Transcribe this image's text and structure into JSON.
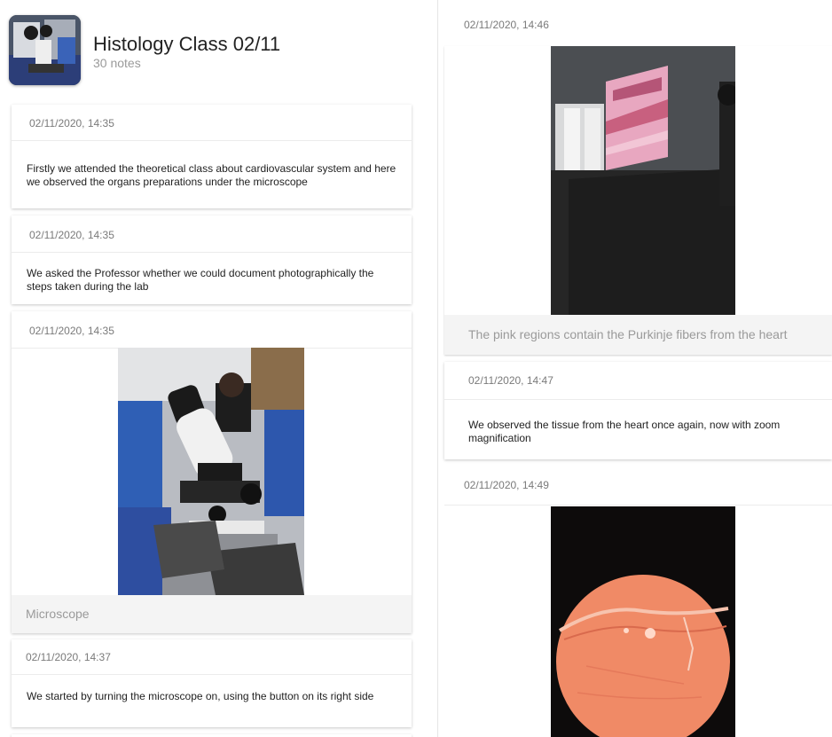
{
  "header": {
    "title": "Histology Class 02/11",
    "subtitle": "30 notes"
  },
  "notes_left": [
    {
      "timestamp": "02/11/2020, 14:35",
      "text": "Firstly we attended the theoretical class about cardiovascular system and here we observed the organs preparations under the microscope"
    },
    {
      "timestamp": "02/11/2020, 14:35",
      "text": "We asked the Professor whether we could document photographically the steps taken during the lab"
    },
    {
      "timestamp": "02/11/2020, 14:35",
      "caption": "Microscope"
    },
    {
      "timestamp": "02/11/2020, 14:37",
      "text": "We started by turning the microscope on, using the button on its right side"
    }
  ],
  "notes_right": [
    {
      "timestamp": "02/11/2020, 14:46",
      "caption": "The pink regions contain the Purkinje fibers from the heart"
    },
    {
      "timestamp": "02/11/2020, 14:47",
      "text": "We observed the tissue from the heart once again, now with zoom magnification"
    },
    {
      "timestamp": "02/11/2020, 14:49"
    }
  ],
  "colors": {
    "caption_bar": "#f4f4f4",
    "timestamp": "#7a7a7a",
    "slide_pink": "#e8a7c0",
    "micro_orange": "#f08a66"
  },
  "images": {
    "avatar": "microscope-lab-thumbnail",
    "photo_microscope": "microscope-photo",
    "photo_projection": "projected-histology-slide-photo",
    "photo_micrograph": "heart-tissue-micrograph-photo"
  }
}
